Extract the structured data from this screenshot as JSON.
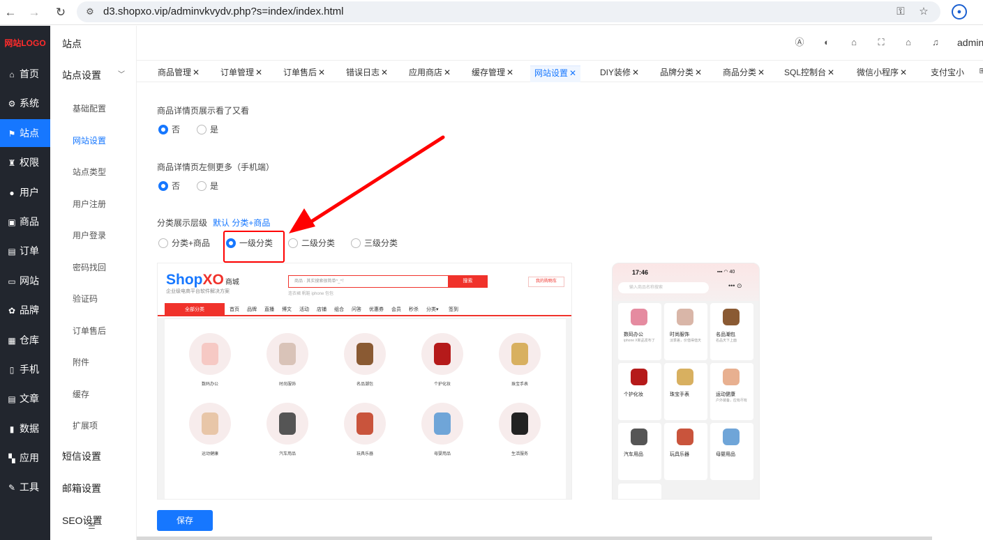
{
  "browser": {
    "url": "d3.shopxo.vip/adminvkvydv.php?s=index/index.html"
  },
  "sidebar": {
    "logo": "网站LOGO",
    "items": [
      {
        "label": "首页",
        "icon": "home-icon",
        "glyph": "⌂"
      },
      {
        "label": "系统",
        "icon": "gear-icon",
        "glyph": "⚙"
      },
      {
        "label": "站点",
        "icon": "site-icon",
        "glyph": "⚑",
        "active": true
      },
      {
        "label": "权限",
        "icon": "permission-icon",
        "glyph": "♜"
      },
      {
        "label": "用户",
        "icon": "user-icon",
        "glyph": "●"
      },
      {
        "label": "商品",
        "icon": "goods-icon",
        "glyph": "▣"
      },
      {
        "label": "订单",
        "icon": "order-icon",
        "glyph": "▤"
      },
      {
        "label": "网站",
        "icon": "website-icon",
        "glyph": "▭"
      },
      {
        "label": "品牌",
        "icon": "brand-icon",
        "glyph": "✿"
      },
      {
        "label": "仓库",
        "icon": "warehouse-icon",
        "glyph": "▦"
      },
      {
        "label": "手机",
        "icon": "mobile-icon",
        "glyph": "▯"
      },
      {
        "label": "文章",
        "icon": "article-icon",
        "glyph": "▤"
      },
      {
        "label": "数据",
        "icon": "data-icon",
        "glyph": "▮"
      },
      {
        "label": "应用",
        "icon": "apps-icon",
        "glyph": "▚"
      },
      {
        "label": "工具",
        "icon": "tool-icon",
        "glyph": "✎"
      }
    ]
  },
  "submenu": {
    "title": "站点",
    "group": "站点设置",
    "items": [
      "基础配置",
      "网站设置",
      "站点类型",
      "用户注册",
      "用户登录",
      "密码找回",
      "验证码",
      "订单售后",
      "附件",
      "缓存",
      "扩展项"
    ],
    "active_index": 1,
    "extra_groups": [
      "短信设置",
      "邮箱设置",
      "SEO设置"
    ]
  },
  "header": {
    "user": "admin"
  },
  "tabs": [
    {
      "label": "商品管理"
    },
    {
      "label": "订单管理"
    },
    {
      "label": "订单售后"
    },
    {
      "label": "错误日志"
    },
    {
      "label": "应用商店"
    },
    {
      "label": "缓存管理"
    },
    {
      "label": "网站设置",
      "active": true
    },
    {
      "label": "DIY装修"
    },
    {
      "label": "品牌分类"
    },
    {
      "label": "商品分类"
    },
    {
      "label": "SQL控制台"
    },
    {
      "label": "微信小程序"
    },
    {
      "label": "支付宝小"
    }
  ],
  "form": {
    "field1": {
      "label": "商品详情页展示看了又看",
      "options": [
        "否",
        "是"
      ],
      "selected": 0
    },
    "field2": {
      "label": "商品详情页左侧更多（手机端）",
      "options": [
        "否",
        "是"
      ],
      "selected": 0
    },
    "field3": {
      "label": "分类展示层级",
      "hint": "默认 分类+商品",
      "options": [
        "分类+商品",
        "一级分类",
        "二级分类",
        "三级分类"
      ],
      "selected": 1
    },
    "save_label": "保存"
  },
  "pc_preview": {
    "logo_a": "Shop",
    "logo_b": "XO",
    "logo_c": "商城",
    "subtitle": "企业级电商平台软件解决方案",
    "search_placeholder": "商品 · 其实搜索很简单^_^！",
    "search_button": "搜索",
    "cart": "我的购物车",
    "hot": "连衣裙  帆鞋  iphone  包包",
    "all_categories": "全部分类",
    "nav": [
      "首页",
      "品牌",
      "直播",
      "博文",
      "活动",
      "店铺",
      "组合",
      "问答",
      "优惠券",
      "会员",
      "秒杀",
      "分类▾",
      "签到"
    ],
    "categories": [
      "数码办公",
      "时尚服饰",
      "名品潮包",
      "个护化妆",
      "珠宝手表",
      "运动健康",
      "汽车用品",
      "玩具乐器",
      "母婴用品",
      "生活服务"
    ],
    "colors": {
      "accent": "#f0322b",
      "blue": "#1677ff"
    }
  },
  "mobile_preview": {
    "time": "17:46",
    "status": "▪▪▪ ◠ 40",
    "search_placeholder": "输入商品名称搜索",
    "dots": "•••  ⊙",
    "cards": [
      {
        "label": "数码办公",
        "desc": "iphone X新品发布了"
      },
      {
        "label": "时尚服饰",
        "desc": "淡季差，价值得值天"
      },
      {
        "label": "名品潮包",
        "desc": "名品天下上面"
      },
      {
        "label": "个护化妆",
        "desc": ""
      },
      {
        "label": "珠宝手表",
        "desc": ""
      },
      {
        "label": "运动健康",
        "desc": "户外装备，应有尽有"
      },
      {
        "label": "汽车用品",
        "desc": ""
      },
      {
        "label": "玩具乐器",
        "desc": ""
      },
      {
        "label": "母婴用品",
        "desc": ""
      }
    ]
  },
  "colors": {
    "primary": "#1677ff",
    "sidebar_bg": "#22262e",
    "annotation_red": "#ff0000"
  }
}
